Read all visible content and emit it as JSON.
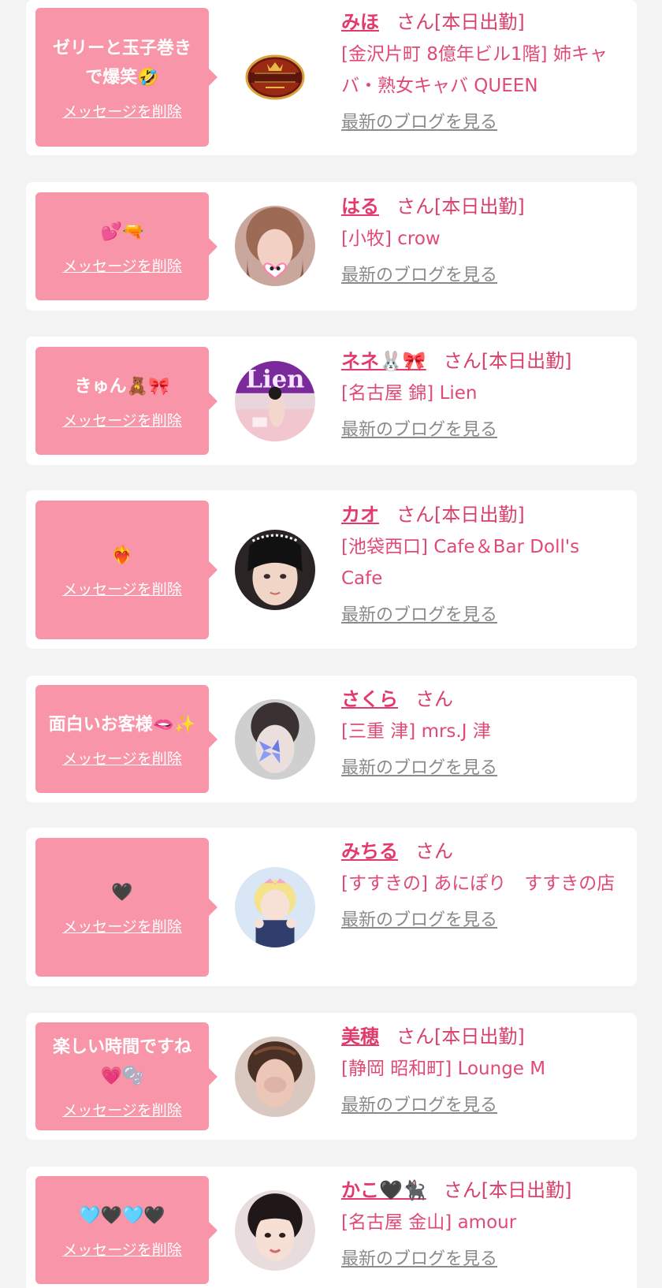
{
  "items": [
    {
      "message": "ゼリーと玉子巻き\nで爆笑🤣",
      "delete_label": "メッセージを削除",
      "name": "みほ",
      "name_suffix": "さん[本日出勤]",
      "shop": "[金沢片町 8億年ビル1階] 姉キャバ・熟女キャバ QUEEN",
      "blog_label": "最新のブログを見る",
      "avatar": "queen-logo"
    },
    {
      "message": "💕🔫",
      "delete_label": "メッセージを削除",
      "name": "はる",
      "name_suffix": "さん[本日出勤]",
      "shop": "[小牧] crow",
      "blog_label": "最新のブログを見る",
      "avatar": "photo"
    },
    {
      "message": "きゅん🧸🎀",
      "delete_label": "メッセージを削除",
      "name": "ネネ🐰🎀",
      "name_suffix": "さん[本日出勤]",
      "shop": "[名古屋 錦] Lien",
      "blog_label": "最新のブログを見る",
      "avatar": "photo"
    },
    {
      "message": "❤️‍🔥",
      "delete_label": "メッセージを削除",
      "name": "カオ",
      "name_suffix": "さん[本日出勤]",
      "shop": "[池袋西口] Cafe＆Bar Doll's Cafe",
      "blog_label": "最新のブログを見る",
      "avatar": "photo"
    },
    {
      "message": "面白いお客様🫦✨",
      "delete_label": "メッセージを削除",
      "name": "さくら",
      "name_suffix": "さん",
      "shop": "[三重 津] mrs.J 津",
      "blog_label": "最新のブログを見る",
      "avatar": "photo"
    },
    {
      "message": "🖤",
      "delete_label": "メッセージを削除",
      "name": "みちる",
      "name_suffix": "さん",
      "shop": "[すすきの] あにぽり　すすきの店",
      "blog_label": "最新のブログを見る",
      "avatar": "photo"
    },
    {
      "message": "楽しい時間ですね\n💗🫧",
      "delete_label": "メッセージを削除",
      "name": "美穂",
      "name_suffix": "さん[本日出勤]",
      "shop": "[静岡 昭和町] Lounge M",
      "blog_label": "最新のブログを見る",
      "avatar": "photo"
    },
    {
      "message": "🩵🖤🩵🖤",
      "delete_label": "メッセージを削除",
      "name": "かこ🖤🐈‍⬛",
      "name_suffix": "さん[本日出勤]",
      "shop": "[名古屋 金山] amour",
      "blog_label": "最新のブログを見る",
      "avatar": "photo"
    }
  ],
  "colors": {
    "page_bg": "#f3f3f3",
    "card_bg": "#ffffff",
    "bubble_bg": "#f895a8",
    "accent": "#e23b6b",
    "link_gray": "#8a8a8a"
  }
}
